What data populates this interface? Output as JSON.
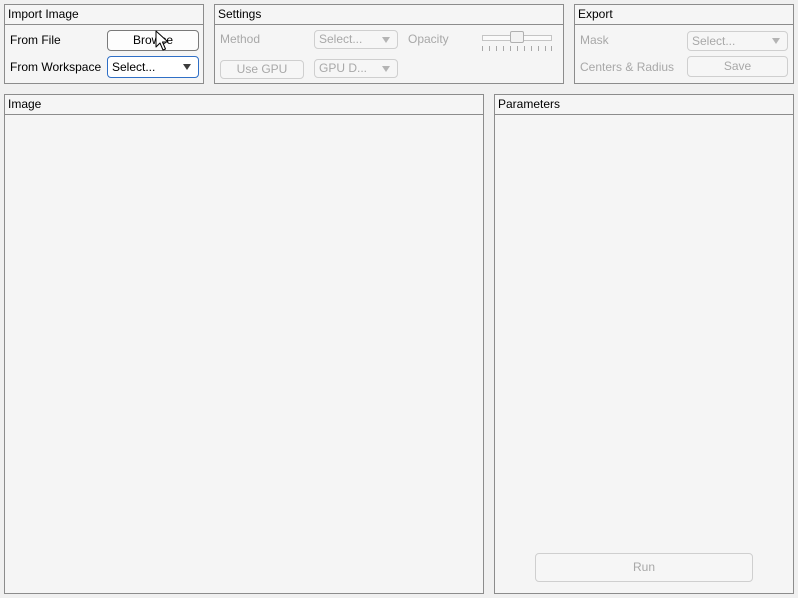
{
  "import_image": {
    "title": "Import Image",
    "from_file_label": "From File",
    "browse_label": "Browse",
    "from_workspace_label": "From Workspace",
    "workspace_select": "Select..."
  },
  "settings": {
    "title": "Settings",
    "method_label": "Method",
    "method_select": "Select...",
    "opacity_label": "Opacity",
    "opacity_value": 0.5,
    "use_gpu_label": "Use GPU",
    "gpu_device_select": "GPU D..."
  },
  "export": {
    "title": "Export",
    "mask_label": "Mask",
    "mask_select": "Select...",
    "centers_radius_label": "Centers & Radius",
    "save_label": "Save"
  },
  "image_panel": {
    "title": "Image"
  },
  "parameters_panel": {
    "title": "Parameters",
    "run_label": "Run"
  },
  "icons": {
    "cursor": "arrow-pointer-icon",
    "dropdown": "triangle-down-icon"
  },
  "colors": {
    "focus_border": "#2f6fc6",
    "disabled_text": "#a8a8a8",
    "panel_bg": "#f5f5f5"
  }
}
